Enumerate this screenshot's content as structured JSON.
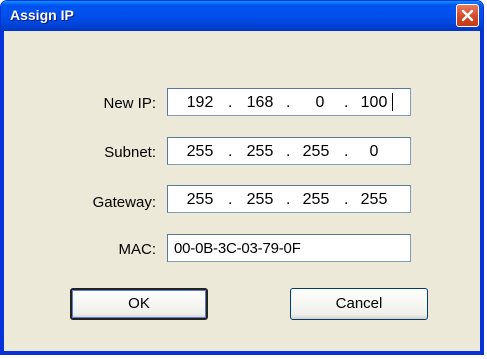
{
  "window": {
    "title": "Assign IP"
  },
  "fields": {
    "new_ip": {
      "label": "New IP:",
      "octets": [
        "192",
        "168",
        "0",
        "100"
      ]
    },
    "subnet": {
      "label": "Subnet:",
      "octets": [
        "255",
        "255",
        "255",
        "0"
      ]
    },
    "gateway": {
      "label": "Gateway:",
      "octets": [
        "255",
        "255",
        "255",
        "255"
      ]
    },
    "mac": {
      "label": "MAC:",
      "value": "00-0B-3C-03-79-0F"
    }
  },
  "separator": ".",
  "buttons": {
    "ok": "OK",
    "cancel": "Cancel"
  },
  "icons": {
    "close": "close-icon"
  },
  "colors": {
    "titlebar": "#0050ee",
    "dialog_bg": "#ece9d8",
    "close": "#d14523"
  }
}
